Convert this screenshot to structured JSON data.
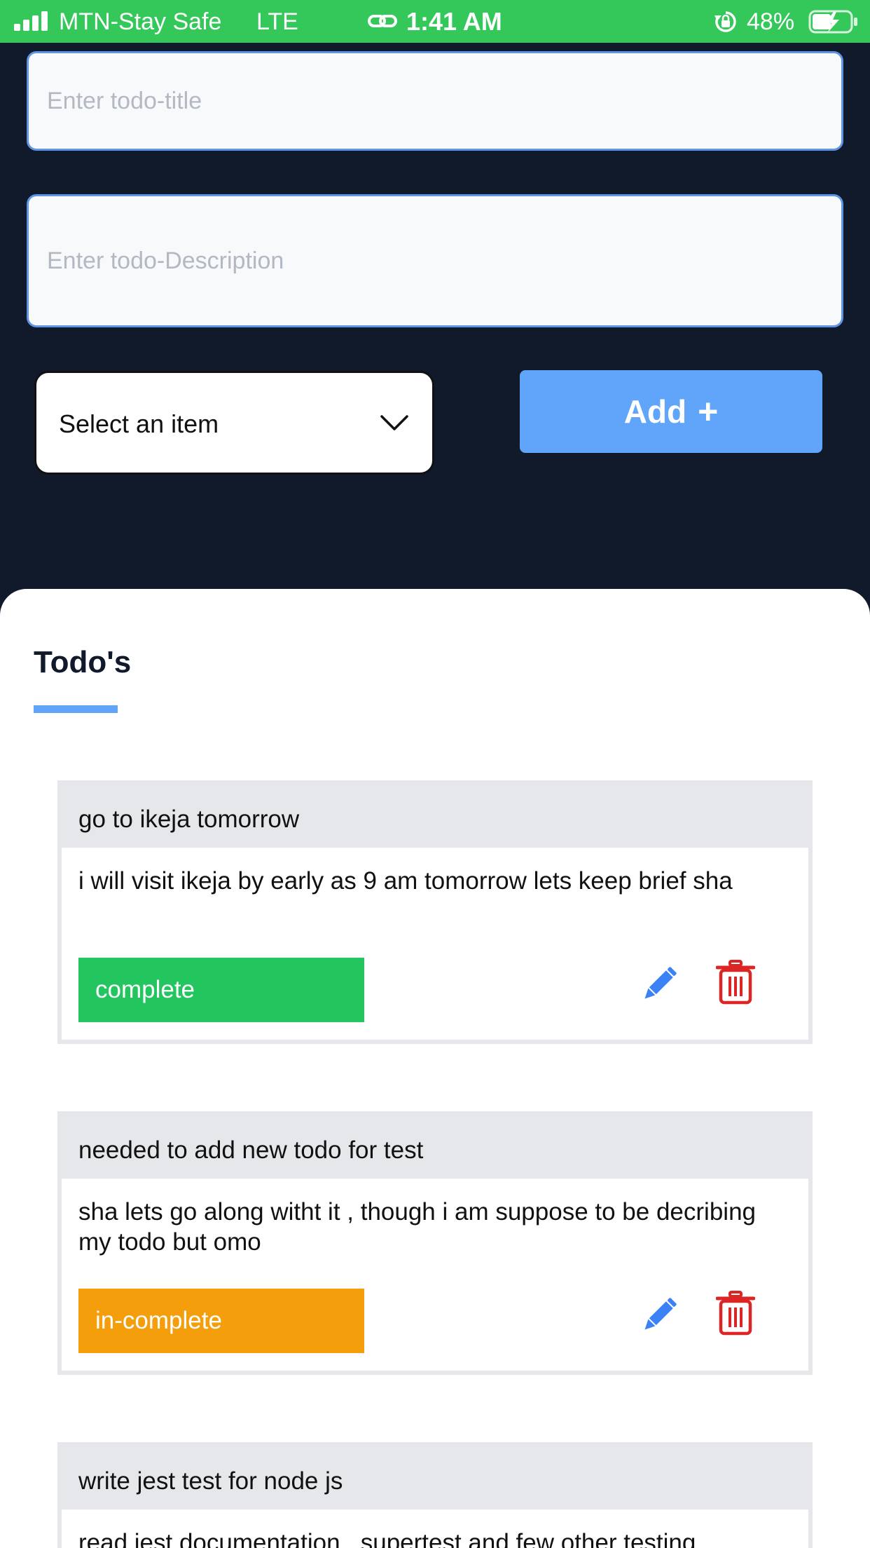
{
  "status_bar": {
    "carrier": "MTN-Stay Safe",
    "network": "LTE",
    "time": "1:41 AM",
    "battery_percent": "48%",
    "icons": [
      "signal-icon",
      "link-icon",
      "orientation-lock-icon",
      "battery-charging-icon"
    ]
  },
  "form": {
    "title_placeholder": "Enter todo-title",
    "description_placeholder": "Enter todo-Description",
    "select_label": "Select an item",
    "add_label": "Add",
    "add_icon": "+"
  },
  "list": {
    "heading": "Todo's",
    "accent_color": "#60a5fa",
    "todos": [
      {
        "title": "go to ikeja tomorrow",
        "description": "i will visit ikeja by early as 9 am tomorrow lets keep brief sha",
        "status": "complete",
        "status_color": "#22c55e"
      },
      {
        "title": "needed to add new todo for test",
        "description": "sha lets go along witht it , though i am suppose to be decribing my todo but omo",
        "status": "in-complete",
        "status_color": "#f59e0b"
      },
      {
        "title": "write jest test for node js",
        "description": "read jest documentation , supertest and few other testing"
      }
    ]
  }
}
